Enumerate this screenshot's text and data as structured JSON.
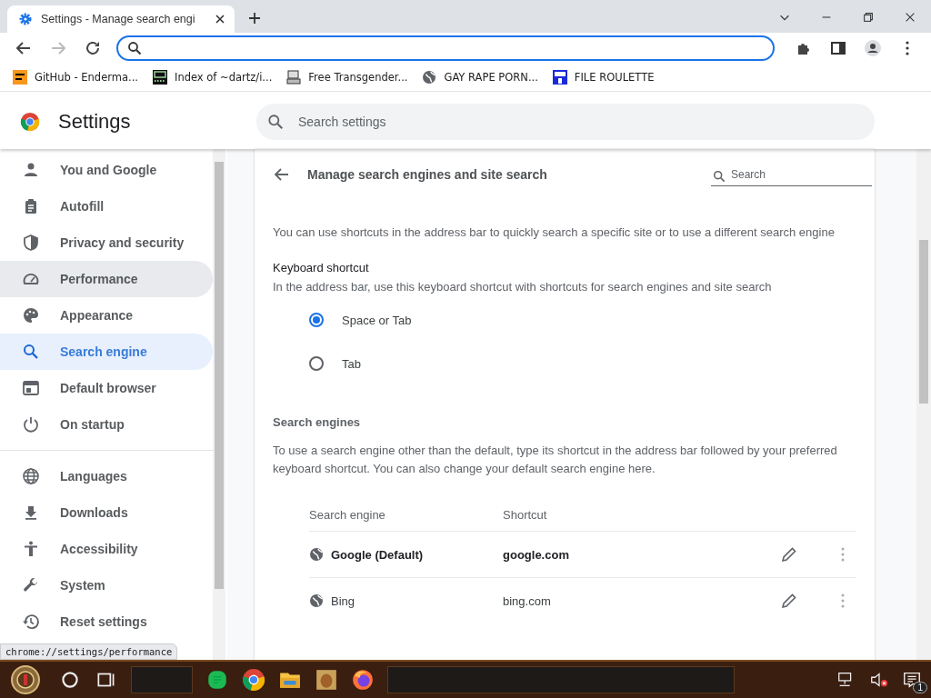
{
  "window": {
    "tab_title": "Settings - Manage search engi"
  },
  "bookmarks": [
    {
      "label": "GitHub - Enderma...",
      "kind": "orange"
    },
    {
      "label": "Index of ~dartz/i...",
      "kind": "dark"
    },
    {
      "label": "Free Transgender...",
      "kind": "computer"
    },
    {
      "label": "GAY RAPE PORN...",
      "kind": "globe"
    },
    {
      "label": "FILE ROULETTE",
      "kind": "blue"
    }
  ],
  "settings": {
    "title": "Settings",
    "search": {
      "placeholder": "Search settings"
    }
  },
  "sidebar": {
    "items": [
      {
        "label": "You and Google",
        "selected": false,
        "hovered": false
      },
      {
        "label": "Autofill",
        "selected": false,
        "hovered": false
      },
      {
        "label": "Privacy and security",
        "selected": false,
        "hovered": false
      },
      {
        "label": "Performance",
        "selected": false,
        "hovered": true
      },
      {
        "label": "Appearance",
        "selected": false,
        "hovered": false
      },
      {
        "label": "Search engine",
        "selected": true,
        "hovered": false
      },
      {
        "label": "Default browser",
        "selected": false,
        "hovered": false
      },
      {
        "label": "On startup",
        "selected": false,
        "hovered": false
      },
      {
        "label": "Languages",
        "selected": false,
        "hovered": false
      },
      {
        "label": "Downloads",
        "selected": false,
        "hovered": false
      },
      {
        "label": "Accessibility",
        "selected": false,
        "hovered": false
      },
      {
        "label": "System",
        "selected": false,
        "hovered": false
      },
      {
        "label": "Reset settings",
        "selected": false,
        "hovered": false
      }
    ]
  },
  "status_url": "chrome://settings/performance",
  "page": {
    "title": "Manage search engines and site search",
    "search": {
      "placeholder": "Search"
    },
    "intro": "You can use shortcuts in the address bar to quickly search a specific site or to use a different search engine",
    "keyboard_shortcut": {
      "heading": "Keyboard shortcut",
      "description": "In the address bar, use this keyboard shortcut with shortcuts for search engines and site search",
      "options": [
        {
          "label": "Space or Tab",
          "selected": true
        },
        {
          "label": "Tab",
          "selected": false
        }
      ]
    },
    "search_engines": {
      "heading": "Search engines",
      "description": "To use a search engine other than the default, type its shortcut in the address bar followed by your preferred keyboard shortcut. You can also change your default search engine here.",
      "columns": [
        "Search engine",
        "Shortcut"
      ],
      "rows": [
        {
          "name": "Google (Default)",
          "shortcut": "google.com",
          "default": true
        },
        {
          "name": "Bing",
          "shortcut": "bing.com",
          "default": false
        }
      ]
    }
  },
  "taskbar": {
    "notification_count": "1"
  }
}
